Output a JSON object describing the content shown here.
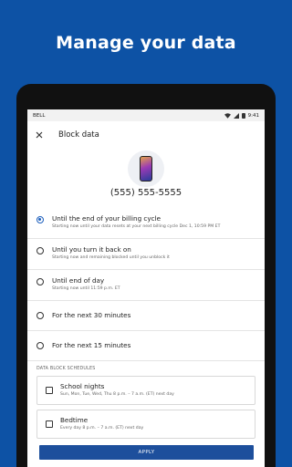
{
  "headline": "Manage your data",
  "status_bar": {
    "carrier": "BELL",
    "time": "9:41"
  },
  "app_bar": {
    "close_icon": "close-icon",
    "title": "Block data"
  },
  "phone_number": "(555) 555-5555",
  "options": [
    {
      "title": "Until the end of your billing cycle",
      "subtitle": "Starting now until your data resets at your next billing cycle Dec 1, 10:59 PM ET",
      "selected": true
    },
    {
      "title": "Until you turn it back on",
      "subtitle": "Starting now and remaining blocked until you unblock it",
      "selected": false
    },
    {
      "title": "Until end of day",
      "subtitle": "Starting now until 11:59 p.m. ET",
      "selected": false
    },
    {
      "title": "For the next 30 minutes",
      "subtitle": "",
      "selected": false
    },
    {
      "title": "For the next 15 minutes",
      "subtitle": "",
      "selected": false
    }
  ],
  "schedules": {
    "label": "DATA BLOCK SCHEDULES",
    "items": [
      {
        "title": "School nights",
        "subtitle": "Sun, Mon, Tue, Wed, Thu 8 p.m. – 7 a.m. (ET) next day"
      },
      {
        "title": "Bedtime",
        "subtitle": "Every day 8 p.m. – 7 a.m. (ET) next day"
      }
    ]
  },
  "apply_label": "APPLY",
  "colors": {
    "background": "#0d52a5",
    "accent": "#1d5fbd",
    "button": "#1d4f9c"
  }
}
